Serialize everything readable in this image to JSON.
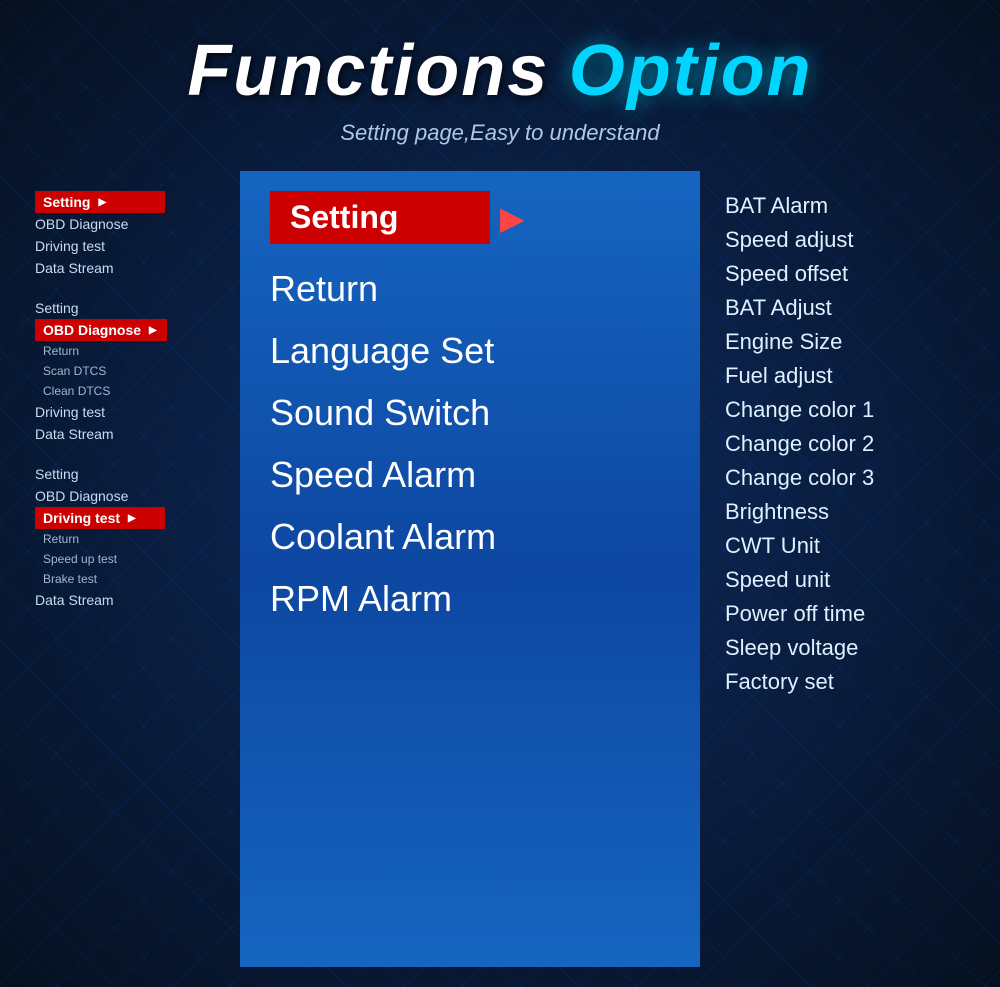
{
  "header": {
    "title_part1": "Functions",
    "title_part2": "Option",
    "subtitle": "Setting page,Easy to understand"
  },
  "left_panel": {
    "groups": [
      {
        "items": [
          {
            "label": "Setting",
            "type": "highlight",
            "arrow": true
          },
          {
            "label": "OBD Diagnose",
            "type": "normal"
          },
          {
            "label": "Driving test",
            "type": "normal"
          },
          {
            "label": "Data Stream",
            "type": "normal"
          }
        ]
      },
      {
        "items": [
          {
            "label": "Setting",
            "type": "normal"
          },
          {
            "label": "OBD Diagnose",
            "type": "highlight",
            "arrow": true
          },
          {
            "label": "Return",
            "type": "small"
          },
          {
            "label": "Scan DTCS",
            "type": "small"
          },
          {
            "label": "Clean DTCS",
            "type": "small"
          },
          {
            "label": "Driving test",
            "type": "normal"
          },
          {
            "label": "Data Stream",
            "type": "normal"
          }
        ]
      },
      {
        "items": [
          {
            "label": "Setting",
            "type": "normal"
          },
          {
            "label": "OBD Diagnose",
            "type": "normal"
          },
          {
            "label": "Driving test",
            "type": "highlight",
            "arrow": true
          },
          {
            "label": "Return",
            "type": "small"
          },
          {
            "label": "Speed up test",
            "type": "small"
          },
          {
            "label": "Brake test",
            "type": "small"
          },
          {
            "label": "Data Stream",
            "type": "normal"
          }
        ]
      }
    ]
  },
  "center_panel": {
    "header_label": "Setting",
    "menu_items": [
      {
        "label": "Return"
      },
      {
        "label": "Language Set"
      },
      {
        "label": "Sound Switch"
      },
      {
        "label": "Speed Alarm"
      },
      {
        "label": "Coolant Alarm"
      },
      {
        "label": "RPM Alarm"
      }
    ]
  },
  "right_panel": {
    "items": [
      {
        "label": "BAT Alarm"
      },
      {
        "label": "Speed adjust"
      },
      {
        "label": "Speed offset"
      },
      {
        "label": "BAT Adjust"
      },
      {
        "label": "Engine Size"
      },
      {
        "label": "Fuel adjust"
      },
      {
        "label": "Change color 1"
      },
      {
        "label": "Change color 2"
      },
      {
        "label": "Change color 3"
      },
      {
        "label": "Brightness"
      },
      {
        "label": "CWT Unit"
      },
      {
        "label": "Speed unit"
      },
      {
        "label": "Power off time"
      },
      {
        "label": "Sleep voltage"
      },
      {
        "label": "Factory set"
      }
    ]
  }
}
